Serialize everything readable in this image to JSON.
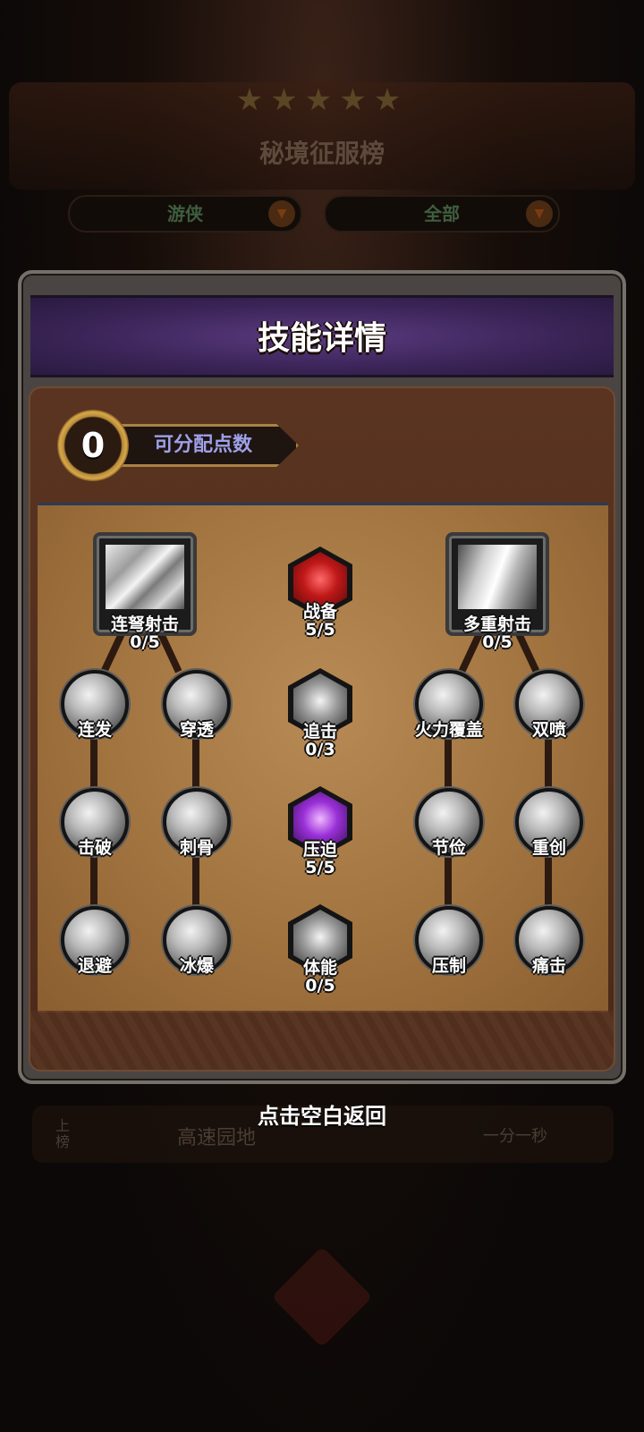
{
  "background": {
    "leaderboard_title": "秘境征服榜",
    "class_filter": "游侠",
    "scope_filter": "全部",
    "row_rank": "上榜",
    "row_name": "高速园地",
    "row_time": "一分一秒"
  },
  "modal": {
    "title": "技能详情",
    "points_value": "0",
    "points_label": "可分配点数"
  },
  "skills": {
    "left_main": {
      "name": "连弩射击",
      "level": "0/5"
    },
    "right_main": {
      "name": "多重射击",
      "level": "0/5"
    },
    "left_tree": [
      "连发",
      "穿透",
      "击破",
      "刺骨",
      "退避",
      "冰爆"
    ],
    "right_tree": [
      "火力覆盖",
      "双喷",
      "节俭",
      "重创",
      "压制",
      "痛击"
    ],
    "center": [
      {
        "name": "战备",
        "level": "5/5",
        "color": "#c01818"
      },
      {
        "name": "追击",
        "level": "0/3",
        "color": "#9a9a9a"
      },
      {
        "name": "压迫",
        "level": "5/5",
        "color": "#9a30d8"
      },
      {
        "name": "体能",
        "level": "0/5",
        "color": "#9a9a9a"
      }
    ]
  },
  "footer": {
    "hint": "点击空白返回"
  }
}
